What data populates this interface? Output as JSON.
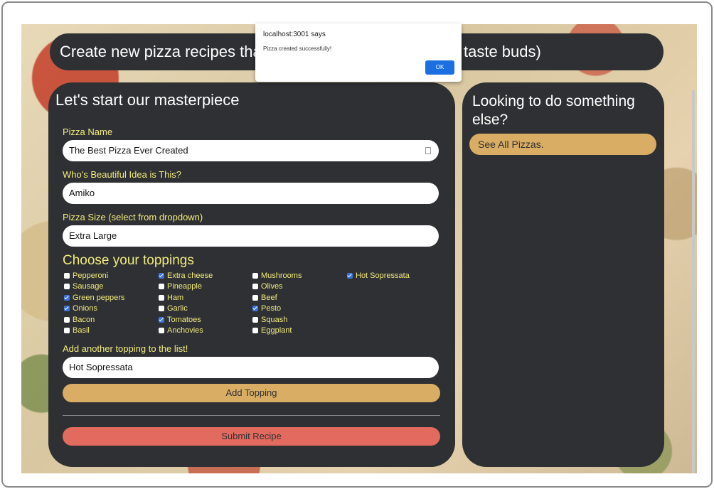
{
  "header": {
    "title_left": "Create new pizza recipes that",
    "title_right": "taste buds)"
  },
  "form": {
    "title": "Let's start our masterpiece",
    "pizza_name": {
      "label": "Pizza Name",
      "value": "The Best Pizza Ever Created"
    },
    "author": {
      "label": "Who's Beautiful Idea is This?",
      "value": "Amiko"
    },
    "size": {
      "label": "Pizza Size (select from dropdown)",
      "value": "Extra Large"
    },
    "toppings_title": "Choose your toppings",
    "toppings": [
      {
        "label": "Pepperoni",
        "checked": false
      },
      {
        "label": "Sausage",
        "checked": false
      },
      {
        "label": "Green peppers",
        "checked": true
      },
      {
        "label": "Onions",
        "checked": true
      },
      {
        "label": "Bacon",
        "checked": false
      },
      {
        "label": "Basil",
        "checked": false
      },
      {
        "label": "Extra cheese",
        "checked": true
      },
      {
        "label": "Pineapple",
        "checked": false
      },
      {
        "label": "Ham",
        "checked": false
      },
      {
        "label": "Garlic",
        "checked": false
      },
      {
        "label": "Tomatoes",
        "checked": true
      },
      {
        "label": "Anchovies",
        "checked": false
      },
      {
        "label": "Mushrooms",
        "checked": false
      },
      {
        "label": "Olives",
        "checked": false
      },
      {
        "label": "Beef",
        "checked": false
      },
      {
        "label": "Pesto",
        "checked": true
      },
      {
        "label": "Squash",
        "checked": false
      },
      {
        "label": "Eggplant",
        "checked": false
      },
      {
        "label": "Hot Sopressata",
        "checked": true
      }
    ],
    "add_topping": {
      "label": "Add another topping to the list!",
      "value": "Hot Sopressata",
      "button": "Add Topping"
    },
    "submit_label": "Submit Recipe"
  },
  "sidebar": {
    "title": "Looking to do something else?",
    "link": "See All Pizzas."
  },
  "alert": {
    "origin": "localhost:3001 says",
    "message": "Pizza created successfully!",
    "ok_label": "OK"
  },
  "colors": {
    "card": "#2e3033",
    "label": "#f3eb7e",
    "gold": "#d9ad63",
    "submit": "#e36a5f",
    "checkbox": "#3a74e0",
    "alert_button": "#1b6fe0"
  },
  "icons": {
    "pizza_name_field": "contact-card-icon",
    "checkbox_checked": "check-icon"
  }
}
